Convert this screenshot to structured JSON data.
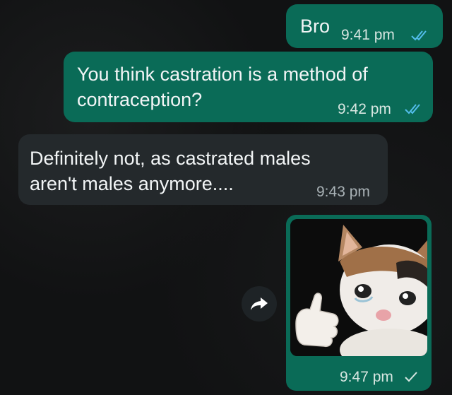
{
  "messages": [
    {
      "text": "Bro",
      "time": "9:41 pm"
    },
    {
      "text_line1": "You think castration is a method of",
      "text_line2": "contraception?",
      "time": "9:42 pm"
    },
    {
      "text_line1": "Definitely not, as castrated males",
      "text_line2": "aren't males anymore....",
      "time": "9:43 pm"
    },
    {
      "image": "crying-cat-thumbs-up",
      "time": "9:47 pm"
    }
  ],
  "colors": {
    "outgoing": "#0a6b57",
    "incoming": "#24292c",
    "read_ticks": "#53bdeb"
  },
  "icons": {
    "read": "double-check-icon",
    "sent": "single-check-icon",
    "forward": "forward-arrow-icon"
  }
}
